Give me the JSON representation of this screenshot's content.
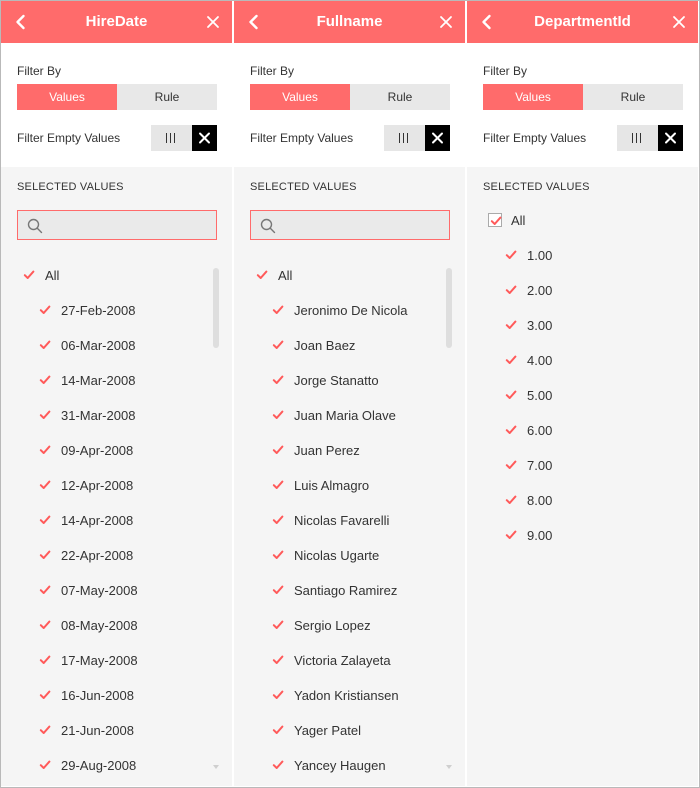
{
  "colors": {
    "accent": "#ff6b6b",
    "panel_bg": "#f5f5f5",
    "toggle_off": "#000000"
  },
  "panels": [
    {
      "title": "HireDate",
      "filter_by": "Filter By",
      "tab_values": "Values",
      "tab_rule": "Rule",
      "filter_empty": "Filter Empty Values",
      "selected_values": "SELECTED VALUES",
      "has_search": true,
      "search_placeholder": "",
      "all_label": "All",
      "items": [
        "27-Feb-2008",
        "06-Mar-2008",
        "14-Mar-2008",
        "31-Mar-2008",
        "09-Apr-2008",
        "12-Apr-2008",
        "14-Apr-2008",
        "22-Apr-2008",
        "07-May-2008",
        "08-May-2008",
        "17-May-2008",
        "16-Jun-2008",
        "21-Jun-2008",
        "29-Aug-2008"
      ]
    },
    {
      "title": "Fullname",
      "filter_by": "Filter By",
      "tab_values": "Values",
      "tab_rule": "Rule",
      "filter_empty": "Filter Empty Values",
      "selected_values": "SELECTED VALUES",
      "has_search": true,
      "search_placeholder": "",
      "all_label": "All",
      "items": [
        "Jeronimo De Nicola",
        "Joan Baez",
        "Jorge Stanatto",
        "Juan Maria Olave",
        "Juan Perez",
        "Luis Almagro",
        "Nicolas Favarelli",
        "Nicolas Ugarte",
        "Santiago Ramirez",
        "Sergio Lopez",
        "Victoria Zalayeta",
        "Yadon Kristiansen",
        "Yager Patel",
        "Yancey Haugen"
      ]
    },
    {
      "title": "DepartmentId",
      "filter_by": "Filter By",
      "tab_values": "Values",
      "tab_rule": "Rule",
      "filter_empty": "Filter Empty Values",
      "selected_values": "SELECTED VALUES",
      "has_search": false,
      "search_placeholder": "",
      "all_label": "All",
      "items": [
        "1.00",
        "2.00",
        "3.00",
        "4.00",
        "5.00",
        "6.00",
        "7.00",
        "8.00",
        "9.00"
      ]
    }
  ]
}
